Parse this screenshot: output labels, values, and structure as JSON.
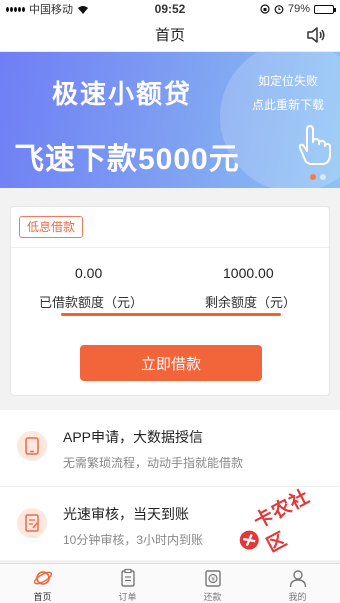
{
  "status_bar": {
    "carrier": "中国移动",
    "time": "09:52",
    "battery": "79%",
    "battery_level": 0.79
  },
  "nav": {
    "title": "首页"
  },
  "banner": {
    "title": "极速小额贷",
    "amount_text": "飞速下款5000元",
    "note_line1": "如定位失败",
    "note_line2": "点此重新下载"
  },
  "loan_card": {
    "tag": "低息借款",
    "borrowed_value": "0.00",
    "borrowed_label": "已借款额度（元）",
    "remaining_value": "1000.00",
    "remaining_label": "剩余额度（元）",
    "button_label": "立即借款"
  },
  "features": [
    {
      "title": "APP申请，大数据授信",
      "subtitle": "无需繁琐流程，动动手指就能借款"
    },
    {
      "title": "光速审核，当天到账",
      "subtitle": "10分钟审核，3小时内到账"
    }
  ],
  "tabs": [
    {
      "label": "首页"
    },
    {
      "label": "订单"
    },
    {
      "label": "还款"
    },
    {
      "label": "我的"
    }
  ],
  "watermark": {
    "text": "卡农社区"
  },
  "colors": {
    "accent": "#f2643a",
    "banner_start": "#6f7ef5",
    "banner_end": "#8cc3f4"
  }
}
